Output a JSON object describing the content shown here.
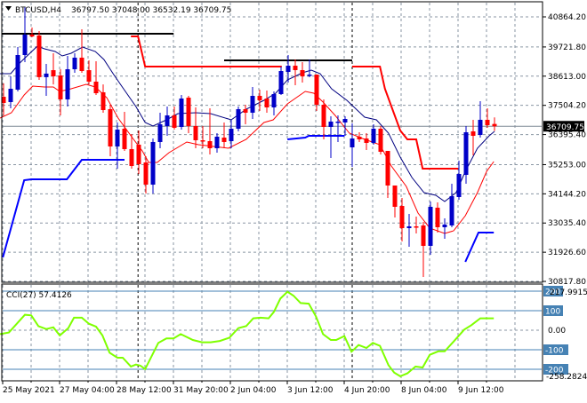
{
  "header": {
    "symbol": "BTCUSD,H4",
    "ohlc": "36797.50 37048.00 36532.19 36709.75"
  },
  "colors": {
    "bull": "#0000c8",
    "bear": "#ff0000",
    "ma_fast": "#000080",
    "ma_slow": "#ff0000",
    "resistance": "#ff0000",
    "support": "#0000ff",
    "level": "#000000",
    "cci": "#7fff00",
    "cci_levels": "#4682b4"
  },
  "chart_data": [
    {
      "type": "candlestick",
      "title": "BTCUSD,H4",
      "ylim": [
        30817.8,
        41300
      ],
      "y_ticks": [
        "40864.20",
        "39721.80",
        "38613.00",
        "37504.20",
        "36395.40",
        "35253.00",
        "34144.20",
        "33035.40",
        "31926.60",
        "30817.80"
      ],
      "y_tick_values": [
        40864.2,
        39721.8,
        38613.0,
        37504.2,
        36395.4,
        35253.0,
        34144.2,
        33035.4,
        31926.6,
        30817.8
      ],
      "current_price": "36709.75",
      "current_price_value": 36709.75,
      "x_labels": [
        "25 May 2021",
        "27 May 04:00",
        "28 May 12:00",
        "31 May 20:00",
        "2 Jun 04:00",
        "3 Jun 12:00",
        "4 Jun 20:00",
        "8 Jun 04:00",
        "9 Jun 12:00"
      ],
      "x_label_bars": [
        0,
        8,
        16,
        24,
        32,
        40,
        48,
        56,
        64
      ],
      "grid": true,
      "separators_at_bar": [
        18.9,
        49
      ],
      "candles_ohlc": [
        [
          37830,
          38340,
          37120,
          37595
        ],
        [
          37629,
          38606,
          37393,
          38134
        ],
        [
          38100,
          39718,
          38033,
          39415
        ],
        [
          39415,
          41235,
          39145,
          40190
        ],
        [
          40190,
          40460,
          40090,
          40120
        ],
        [
          40157,
          40325,
          38470,
          38575
        ],
        [
          38575,
          39077,
          37865,
          38710
        ],
        [
          38840,
          39482,
          38300,
          38606
        ],
        [
          38640,
          38880,
          37123,
          37730
        ],
        [
          37730,
          39380,
          37460,
          38875
        ],
        [
          38875,
          39482,
          38740,
          39315
        ],
        [
          39315,
          40392,
          38740,
          38808
        ],
        [
          38840,
          39213,
          38300,
          38404
        ],
        [
          38404,
          39180,
          37898,
          37965
        ],
        [
          38000,
          38300,
          37225,
          37325
        ],
        [
          37360,
          37527,
          35572,
          35943
        ],
        [
          35943,
          36854,
          35100,
          36584
        ],
        [
          36617,
          37258,
          35774,
          35842
        ],
        [
          35842,
          36415,
          35100,
          35201
        ],
        [
          36010,
          36550,
          34898,
          35269
        ],
        [
          35336,
          35572,
          34156,
          34493
        ],
        [
          34493,
          36247,
          34156,
          36112
        ],
        [
          36112,
          37225,
          35875,
          36786
        ],
        [
          36718,
          37460,
          36347,
          37123
        ],
        [
          37123,
          37460,
          36584,
          36651
        ],
        [
          36685,
          37898,
          36584,
          37763
        ],
        [
          37797,
          37865,
          36449,
          36718
        ],
        [
          36718,
          37427,
          35875,
          36179
        ],
        [
          36179,
          36718,
          35875,
          36145
        ],
        [
          36145,
          37393,
          35639,
          35875
        ],
        [
          35875,
          36449,
          35707,
          36314
        ],
        [
          36280,
          36854,
          35875,
          36112
        ],
        [
          36145,
          36955,
          35875,
          36617
        ],
        [
          36617,
          37460,
          36516,
          37359
        ],
        [
          37359,
          37527,
          36786,
          37225
        ],
        [
          37225,
          38201,
          36988,
          37864
        ],
        [
          37864,
          38100,
          37292,
          37696
        ],
        [
          37763,
          38066,
          37225,
          37426
        ],
        [
          37426,
          38033,
          37123,
          37932
        ],
        [
          37932,
          38977,
          37898,
          38808
        ],
        [
          38774,
          39415,
          38370,
          39010
        ],
        [
          39010,
          39246,
          38269,
          38842
        ],
        [
          38842,
          39145,
          38370,
          38606
        ],
        [
          38640,
          39246,
          38572,
          38673
        ],
        [
          38673,
          38673,
          37292,
          37527
        ],
        [
          37527,
          37730,
          36213,
          36685
        ],
        [
          36685,
          37089,
          35505,
          36887
        ],
        [
          36853,
          37123,
          36112,
          36887
        ],
        [
          36853,
          37089,
          36347,
          36988
        ],
        [
          35909,
          36820,
          35167,
          36246
        ],
        [
          36314,
          36482,
          36112,
          36213
        ],
        [
          36246,
          36449,
          35808,
          36078
        ],
        [
          36078,
          36786,
          36010,
          36617
        ],
        [
          36617,
          36718,
          35639,
          35741
        ],
        [
          35774,
          35774,
          33988,
          34460
        ],
        [
          34460,
          34460,
          33246,
          33651
        ],
        [
          33684,
          33988,
          32336,
          32841
        ],
        [
          32841,
          33381,
          32134,
          32909
        ],
        [
          32909,
          33280,
          32640,
          32875
        ],
        [
          32943,
          33078,
          30988,
          32168
        ],
        [
          32168,
          33853,
          31830,
          33651
        ],
        [
          33617,
          33820,
          32673,
          32875
        ],
        [
          32875,
          33213,
          32437,
          32977
        ],
        [
          32943,
          34527,
          32875,
          34055
        ],
        [
          34022,
          35404,
          33920,
          34898
        ],
        [
          34864,
          36718,
          34527,
          36482
        ],
        [
          36516,
          36955,
          35606,
          36347
        ],
        [
          36381,
          37662,
          36280,
          36955
        ],
        [
          36955,
          37393,
          36651,
          36752
        ],
        [
          36797.5,
          37048,
          36532.19,
          36709.75
        ]
      ],
      "ma_fast": [
        [
          -0.5,
          38707
        ],
        [
          1,
          38707
        ],
        [
          2.4,
          39145
        ],
        [
          4.75,
          39752
        ],
        [
          5.75,
          39651
        ],
        [
          7.25,
          39550
        ],
        [
          8.25,
          39381
        ],
        [
          9.5,
          39482
        ],
        [
          11.1,
          39718
        ],
        [
          12.9,
          39550
        ],
        [
          14.1,
          39246
        ],
        [
          15.4,
          38707
        ],
        [
          16.6,
          38235
        ],
        [
          18.6,
          37460
        ],
        [
          19.9,
          36853
        ],
        [
          21,
          36718
        ],
        [
          22.9,
          36954
        ],
        [
          24.5,
          37190
        ],
        [
          27,
          37224
        ],
        [
          29.1,
          37190
        ],
        [
          32,
          36954
        ],
        [
          34.1,
          37359
        ],
        [
          36.6,
          37696
        ],
        [
          38.25,
          37965
        ],
        [
          39.9,
          38471
        ],
        [
          42,
          38741
        ],
        [
          43.25,
          38842
        ],
        [
          44.5,
          38707
        ],
        [
          46.1,
          38134
        ],
        [
          48.25,
          37696
        ],
        [
          50.75,
          37055
        ],
        [
          52.4,
          36954
        ],
        [
          54.1,
          36449
        ],
        [
          55.75,
          35539
        ],
        [
          57.4,
          34763
        ],
        [
          59.1,
          34190
        ],
        [
          60.75,
          34089
        ],
        [
          62,
          33853
        ],
        [
          63.6,
          34190
        ],
        [
          64.9,
          34999
        ],
        [
          66.6,
          35875
        ],
        [
          68.25,
          36347
        ],
        [
          69,
          36516
        ]
      ],
      "ma_slow": [
        [
          -0.5,
          37022
        ],
        [
          1.1,
          37224
        ],
        [
          2.9,
          37898
        ],
        [
          4.1,
          38235
        ],
        [
          5.75,
          38201
        ],
        [
          7,
          38201
        ],
        [
          7.9,
          38033
        ],
        [
          9.5,
          38134
        ],
        [
          11.6,
          38303
        ],
        [
          12.9,
          38201
        ],
        [
          14.5,
          37797
        ],
        [
          16.1,
          37022
        ],
        [
          17.9,
          36348
        ],
        [
          19.5,
          35774
        ],
        [
          20.4,
          35336
        ],
        [
          21.6,
          35336
        ],
        [
          23.25,
          35707
        ],
        [
          25.75,
          36112
        ],
        [
          27.4,
          36011
        ],
        [
          31.6,
          35876
        ],
        [
          34.1,
          36213
        ],
        [
          36.6,
          36853
        ],
        [
          37.9,
          36954
        ],
        [
          39.9,
          37561
        ],
        [
          42.4,
          38033
        ],
        [
          43.6,
          37966
        ],
        [
          44.9,
          37629
        ],
        [
          46.6,
          37123
        ],
        [
          48.6,
          36449
        ],
        [
          50.75,
          36213
        ],
        [
          52.9,
          36011
        ],
        [
          54.5,
          35202
        ],
        [
          56.6,
          34426
        ],
        [
          58.25,
          33415
        ],
        [
          59.9,
          32842
        ],
        [
          62,
          32639
        ],
        [
          63.25,
          32741
        ],
        [
          64.9,
          33314
        ],
        [
          66.6,
          34190
        ],
        [
          67.9,
          34999
        ],
        [
          68.9,
          35370
        ]
      ],
      "resistance": [
        [
          [
            17.9,
            40123
          ],
          [
            18.9,
            40123
          ],
          [
            19.9,
            38977
          ],
          [
            39.1,
            38977
          ]
        ],
        [
          [
            49,
            38977
          ],
          [
            52.9,
            38977
          ],
          [
            53.6,
            38134
          ],
          [
            55.75,
            36550
          ],
          [
            56.75,
            36213
          ],
          [
            58,
            36213
          ],
          [
            58.9,
            35100
          ],
          [
            63.9,
            35100
          ]
        ]
      ],
      "support": [
        [
          [
            -0.1,
            31729
          ],
          [
            2.9,
            34662
          ],
          [
            3.9,
            34696
          ],
          [
            8.9,
            34696
          ],
          [
            11,
            35437
          ],
          [
            17,
            35437
          ]
        ],
        [
          [
            39.9,
            36213
          ],
          [
            42.4,
            36280
          ],
          [
            42.9,
            36347
          ],
          [
            47.9,
            36347
          ]
        ],
        [
          [
            64.9,
            31560
          ],
          [
            66.75,
            32673
          ],
          [
            68.9,
            32673
          ]
        ]
      ],
      "levels": [
        [
          [
            -0.25,
            40224
          ],
          [
            23.9,
            40224
          ]
        ],
        [
          [
            31,
            39213
          ],
          [
            49,
            39213
          ]
        ]
      ]
    },
    {
      "type": "line",
      "title": "CCI(27) 57.4126",
      "ylim": [
        -258.2824,
        217.9915
      ],
      "max_label": "217.9915",
      "min_label": "-258.2824",
      "levels": [
        {
          "value": 200,
          "label": "200"
        },
        {
          "value": 100,
          "label": "100"
        },
        {
          "value": 0,
          "label": "0.00"
        },
        {
          "value": -100,
          "label": "-100"
        },
        {
          "value": -200,
          "label": "-200"
        }
      ],
      "points": [
        [
          -0.5,
          -20
        ],
        [
          0.75,
          -12
        ],
        [
          3,
          79
        ],
        [
          3.9,
          76
        ],
        [
          4.9,
          21
        ],
        [
          6,
          6
        ],
        [
          7,
          15
        ],
        [
          7.9,
          -27
        ],
        [
          9.1,
          11
        ],
        [
          9.9,
          64
        ],
        [
          11,
          64
        ],
        [
          12,
          33
        ],
        [
          13,
          18
        ],
        [
          13.9,
          -27
        ],
        [
          14.9,
          -115
        ],
        [
          16,
          -141
        ],
        [
          16.75,
          -141
        ],
        [
          17.9,
          -186
        ],
        [
          18.6,
          -176
        ],
        [
          19.25,
          -182
        ],
        [
          19.9,
          -199
        ],
        [
          21.75,
          -65
        ],
        [
          22.9,
          -42
        ],
        [
          23.9,
          -42
        ],
        [
          24.9,
          -20
        ],
        [
          26.6,
          -50
        ],
        [
          27.9,
          -62
        ],
        [
          29.1,
          -62
        ],
        [
          30.4,
          -55
        ],
        [
          31.75,
          -38
        ],
        [
          33,
          11
        ],
        [
          34.1,
          21
        ],
        [
          35.1,
          61
        ],
        [
          36.1,
          64
        ],
        [
          37.25,
          61
        ],
        [
          38,
          94
        ],
        [
          38.9,
          162
        ],
        [
          39.9,
          197
        ],
        [
          40.75,
          177
        ],
        [
          41.75,
          139
        ],
        [
          42.9,
          136
        ],
        [
          43.9,
          71
        ],
        [
          44.9,
          -20
        ],
        [
          46,
          -50
        ],
        [
          46.75,
          -50
        ],
        [
          47.9,
          -30
        ],
        [
          48.9,
          -110
        ],
        [
          49.9,
          -76
        ],
        [
          51,
          -91
        ],
        [
          51.9,
          -65
        ],
        [
          52.9,
          -80
        ],
        [
          54.1,
          -179
        ],
        [
          54.9,
          -217
        ],
        [
          55.75,
          -236
        ],
        [
          56.75,
          -221
        ],
        [
          57.9,
          -186
        ],
        [
          58.9,
          -191
        ],
        [
          59.9,
          -126
        ],
        [
          61.1,
          -108
        ],
        [
          62,
          -108
        ],
        [
          63.25,
          -58
        ],
        [
          64.75,
          3
        ],
        [
          65.75,
          26
        ],
        [
          67,
          61
        ],
        [
          68.9,
          61
        ]
      ]
    }
  ]
}
